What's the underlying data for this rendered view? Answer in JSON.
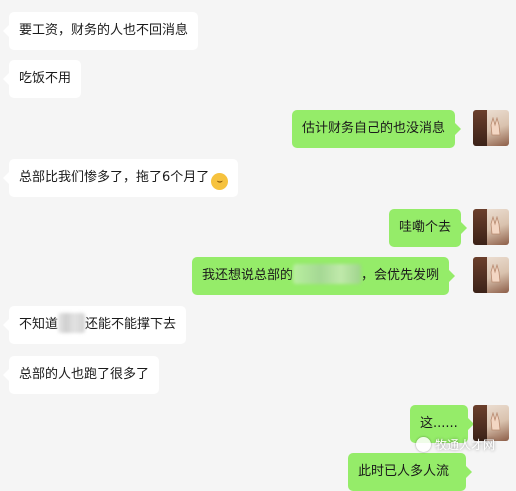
{
  "messages": [
    {
      "side": "in",
      "text": "要工资，财务的人也不回消息"
    },
    {
      "side": "in",
      "text": "吃饭不用"
    },
    {
      "side": "out",
      "text": "估计财务自己的也没消息"
    },
    {
      "side": "in",
      "text": "总部比我们惨多了，拖了6个月了"
    },
    {
      "side": "out",
      "text": "哇嘞个去"
    },
    {
      "side": "out",
      "text_before": "我还想说总部的",
      "text_after": "，会优先发咧"
    },
    {
      "side": "in",
      "text_before": "不知道",
      "text_after": "还能不能撑下去"
    },
    {
      "side": "in",
      "text": "总部的人也跑了很多了"
    },
    {
      "side": "out",
      "text": "这......"
    },
    {
      "side": "out",
      "text": "此时已人多人流"
    }
  ],
  "icons": {
    "emoji": "sweat-laugh-emoji-icon",
    "avatar": "avatar-peace-sign",
    "watermark": "wechat-official-account-icon"
  },
  "watermark": {
    "text": "牧通人才网"
  },
  "colors": {
    "background": "#f5f5f5",
    "incoming_bubble": "#ffffff",
    "outgoing_bubble": "#95ec69"
  }
}
